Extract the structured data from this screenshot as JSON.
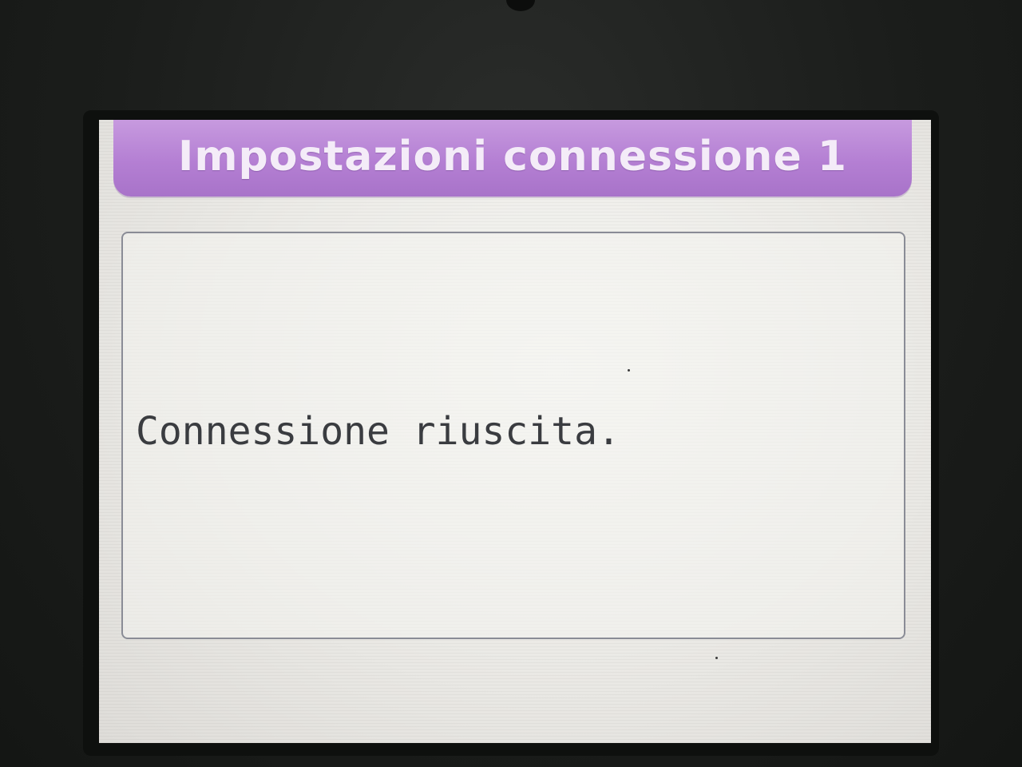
{
  "header": {
    "title": "Impostazioni connessione 1"
  },
  "dialog": {
    "message": "Connessione riuscita."
  },
  "colors": {
    "title_bar": "#b47fd3",
    "title_text": "#f4ecf8",
    "screen_background": "#ecebe7",
    "message_text": "#3a3c40"
  }
}
